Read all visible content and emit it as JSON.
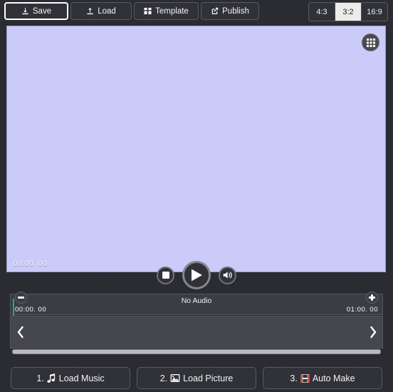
{
  "toolbar": {
    "save": {
      "label": "Save",
      "icon": "download-icon"
    },
    "load": {
      "label": "Load",
      "icon": "upload-icon"
    },
    "template": {
      "label": "Template",
      "icon": "template-grid-icon"
    },
    "publish": {
      "label": "Publish",
      "icon": "share-icon"
    },
    "aspect_ratios": [
      {
        "label": "4:3",
        "selected": false
      },
      {
        "label": "3:2",
        "selected": true
      },
      {
        "label": "16:9",
        "selected": false
      }
    ]
  },
  "canvas": {
    "background_color": "#cbcbfa",
    "timecode": "00:00. 00",
    "grid_button_icon": "grid-icon"
  },
  "transport": {
    "stop": {
      "icon": "stop-icon"
    },
    "play": {
      "icon": "play-icon"
    },
    "volume": {
      "icon": "volume-icon"
    }
  },
  "audio_timeline": {
    "title": "No Audio",
    "zoom_out_label": "-",
    "zoom_in_label": "+",
    "start_time": "00:00. 00",
    "end_time": "01:00. 00"
  },
  "picture_track": {
    "prev_label": "‹",
    "next_label": "›"
  },
  "actions": [
    {
      "number": "1.",
      "label": "Load Music",
      "icon": "music-note-icon"
    },
    {
      "number": "2.",
      "label": "Load Picture",
      "icon": "image-icon"
    },
    {
      "number": "3.",
      "label": "Auto Make",
      "icon": "film-save-icon"
    }
  ],
  "colors": {
    "window_background": "#2b2c31",
    "canvas": "#cbcbfa",
    "accent_playhead": "#2f9e8f",
    "button_face": "#313238",
    "selected_ratio": "#ebebeb"
  }
}
